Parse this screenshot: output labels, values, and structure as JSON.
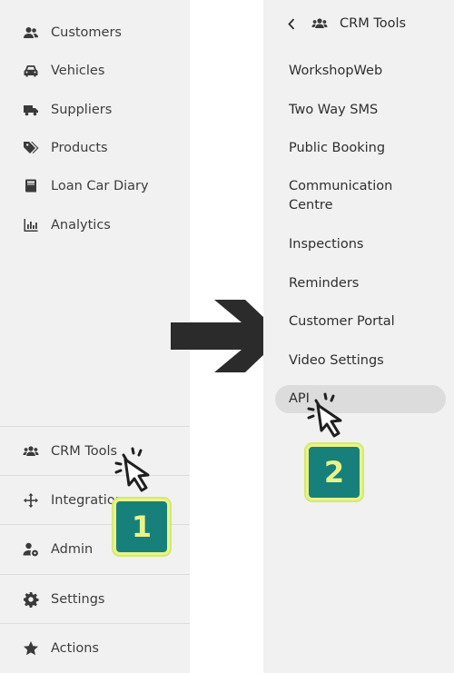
{
  "left_menu": {
    "items": [
      {
        "label": "Customers",
        "icon": "users-icon"
      },
      {
        "label": "Vehicles",
        "icon": "car-icon"
      },
      {
        "label": "Suppliers",
        "icon": "truck-icon"
      },
      {
        "label": "Products",
        "icon": "tags-icon"
      },
      {
        "label": "Loan Car Diary",
        "icon": "book-icon"
      },
      {
        "label": "Analytics",
        "icon": "chart-icon"
      }
    ],
    "bottom_items": [
      {
        "label": "CRM Tools",
        "icon": "crm-users-icon"
      },
      {
        "label": "Integrations",
        "icon": "arrows-icon"
      },
      {
        "label": "Admin",
        "icon": "user-gear-icon"
      },
      {
        "label": "Settings",
        "icon": "gear-icon"
      },
      {
        "label": "Actions",
        "icon": "star-icon"
      }
    ]
  },
  "crm_submenu": {
    "header": "CRM Tools",
    "items": [
      "WorkshopWeb",
      "Two Way SMS",
      "Public Booking",
      "Communication Centre",
      "Inspections",
      "Reminders",
      "Customer Portal",
      "Video Settings",
      "API"
    ]
  },
  "steps": {
    "step1": "1",
    "step2": "2"
  },
  "colors": {
    "panel": "#f1f1f1",
    "badge_bg": "#17807a",
    "badge_fg": "#e8f48a",
    "arrow": "#2b2b2b",
    "highlight": "#dcdcdc"
  }
}
